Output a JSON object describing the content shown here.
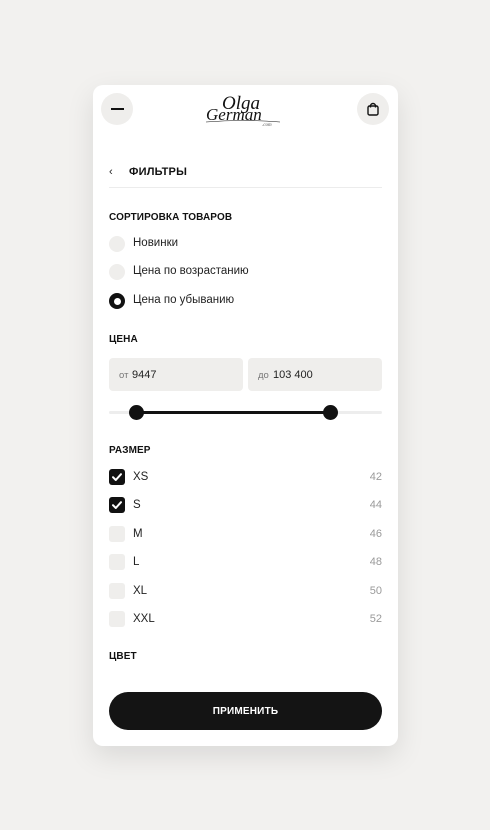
{
  "header": {
    "menu_icon": "minus-icon",
    "bag_icon": "shopping-bag-icon",
    "logo": {
      "line1": "Olga",
      "line2": "German",
      "line3": ".com"
    }
  },
  "filters": {
    "back_icon": "chevron-left-icon",
    "back_label": "‹",
    "title": "ФИЛЬТРЫ"
  },
  "sort": {
    "title": "СОРТИРОВКА ТОВАРОВ",
    "options": [
      {
        "label": "Новинки",
        "selected": false
      },
      {
        "label": "Цена по возрастанию",
        "selected": false
      },
      {
        "label": "Цена по убыванию",
        "selected": true
      }
    ]
  },
  "price": {
    "title": "ЦЕНА",
    "from_prefix": "от",
    "from_value": "9447",
    "to_prefix": "до",
    "to_value": "103 400",
    "range_fraction": [
      0.1,
      0.81
    ]
  },
  "size": {
    "title": "РАЗМЕР",
    "items": [
      {
        "label": "XS",
        "count": "42",
        "checked": true
      },
      {
        "label": "S",
        "count": "44",
        "checked": true
      },
      {
        "label": "M",
        "count": "46",
        "checked": false
      },
      {
        "label": "L",
        "count": "48",
        "checked": false
      },
      {
        "label": "XL",
        "count": "50",
        "checked": false
      },
      {
        "label": "XXL",
        "count": "52",
        "checked": false
      }
    ]
  },
  "color": {
    "title": "ЦВЕТ"
  },
  "apply_label": "ПРИМЕНИТЬ",
  "colors": {
    "accent": "#111111",
    "background": "#f2f1ef",
    "chip": "#efeeec"
  }
}
